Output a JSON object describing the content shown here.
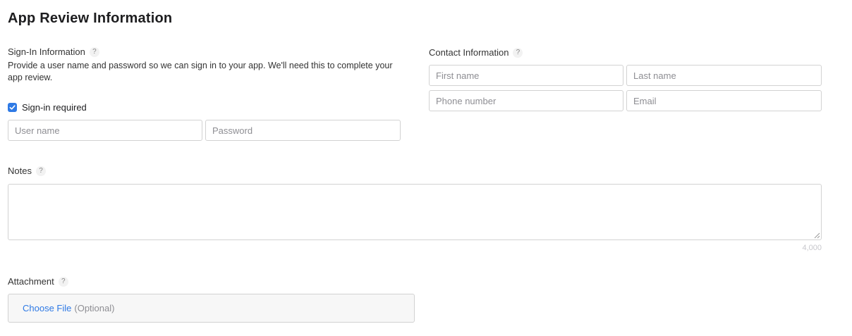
{
  "page": {
    "title": "App Review Information"
  },
  "sign_in": {
    "label": "Sign-In Information",
    "help": "?",
    "description": "Provide a user name and password so we can sign in to your app. We'll need this to complete your app review.",
    "checkbox_label": "Sign-in required",
    "checked": true,
    "username_placeholder": "User name",
    "password_placeholder": "Password"
  },
  "contact": {
    "label": "Contact Information",
    "help": "?",
    "first_name_placeholder": "First name",
    "last_name_placeholder": "Last name",
    "phone_placeholder": "Phone number",
    "email_placeholder": "Email"
  },
  "notes": {
    "label": "Notes",
    "help": "?",
    "value": "",
    "char_limit": "4,000"
  },
  "attachment": {
    "label": "Attachment",
    "help": "?",
    "choose_label": "Choose File",
    "optional_label": "(Optional)"
  },
  "colors": {
    "accent": "#2f7ae5",
    "border": "#d2d2d2",
    "placeholder": "#8e8e93",
    "help_bg": "#f2f2f2"
  },
  "icons": {
    "help": "question-mark",
    "checkbox": "checkmark",
    "resize": "resize-grip"
  }
}
